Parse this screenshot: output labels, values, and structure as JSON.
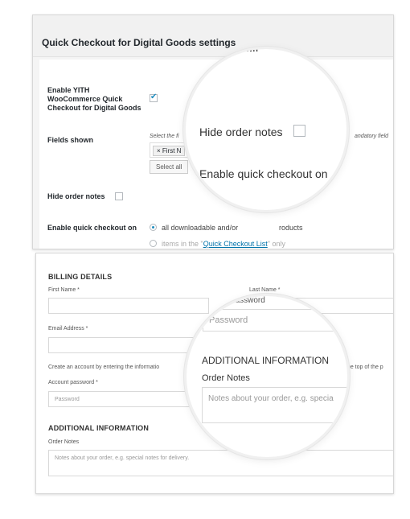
{
  "settings": {
    "title": "Quick Checkout for Digital Goods settings",
    "enable_label": "Enable YITH WooCommerce Quick Checkout for Digital Goods",
    "enable_checked": true,
    "fields_shown_label": "Fields shown",
    "fields_note": "Select the fi",
    "fields_note_right": "andatory field",
    "fields_tag": "× First N",
    "select_all_label": "Select all",
    "hide_notes_label": "Hide order notes",
    "hide_notes_checked": false,
    "quick_checkout_label": "Enable quick checkout on",
    "radio_options": [
      {
        "label": "all downloadable and/or",
        "label_tail": "roducts",
        "selected": true
      },
      {
        "label_prefix": "items in the \"",
        "link": "Quick Checkout List",
        "label_suffix": "\" only",
        "selected": false
      }
    ]
  },
  "magnifier1": {
    "top_partial": "own",
    "hide_notes": "Hide order notes",
    "enable_quick": "Enable quick checkout on"
  },
  "checkout": {
    "billing_title": "BILLING DETAILS",
    "first_name_label": "First Name *",
    "last_name_label": "Last Name *",
    "email_label": "Email Address *",
    "account_info": "Create an account by entering the informatio",
    "account_info_right": "the top of the p",
    "account_password_label": "Account password *",
    "password_placeholder": "Password",
    "additional_title": "ADDITIONAL INFORMATION",
    "order_notes_label": "Order Notes",
    "order_notes_placeholder": "Notes about your order, e.g. special notes for delivery."
  },
  "magnifier2": {
    "partial_label": "password",
    "password_placeholder": "Password",
    "additional_title": "ADDITIONAL INFORMATION",
    "order_notes_label": "Order Notes",
    "notes_placeholder": "Notes about your order, e.g. specia"
  }
}
